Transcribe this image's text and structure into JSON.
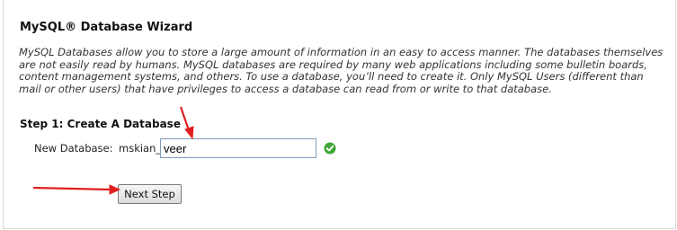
{
  "wizard": {
    "title": "MySQL® Database Wizard",
    "description": "MySQL Databases allow you to store a large amount of information in an easy to access manner. The databases themselves are not easily read by humans. MySQL databases are required by many web applications including some bulletin boards, content management systems, and others. To use a database, you’ll need to create it. Only MySQL Users (different than mail or other users) that have privileges to access a database can read from or write to that database."
  },
  "step": {
    "title": "Step 1: Create A Database",
    "field_label": "New Database:",
    "prefix": "mskian_",
    "value": "veer",
    "status": "valid"
  },
  "actions": {
    "next_label": "Next Step"
  },
  "colors": {
    "annotation_arrow": "#e02020",
    "check_green": "#3fa535"
  },
  "icons": {
    "status": "check-circle-icon"
  }
}
